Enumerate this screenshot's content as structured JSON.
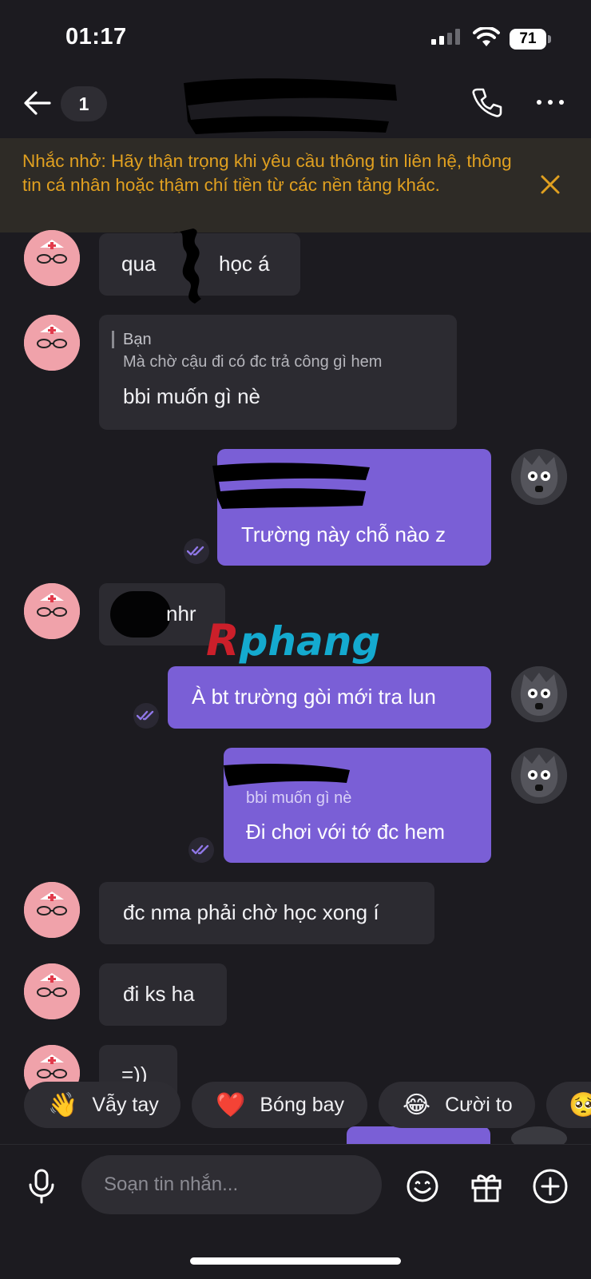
{
  "status_bar": {
    "time": "01:17",
    "battery": "71"
  },
  "header": {
    "unread_count": "1"
  },
  "banner": {
    "text": "Nhắc nhở: Hãy thận trọng khi yêu cầu thông tin liên hệ, thông tin cá nhân hoặc thậm chí tiền từ các nền tảng khác."
  },
  "messages": [
    {
      "dir": "in",
      "text_before": "qua",
      "text_after": "học á"
    },
    {
      "dir": "in",
      "reply_name": "Bạn",
      "reply_text": "Mà chờ cậu đi có đc trả công gì hem",
      "text": "bbi muốn gì nè"
    },
    {
      "dir": "out",
      "text": "Trường này chỗ nào z"
    },
    {
      "dir": "in",
      "text": "nhr"
    },
    {
      "dir": "out",
      "text": "À bt trường gòi mới tra lun"
    },
    {
      "dir": "out",
      "reply_text": "bbi muốn gì nè",
      "text": "Đi chơi với tớ đc hem"
    },
    {
      "dir": "in",
      "text": "đc nma phải chờ học xong í"
    },
    {
      "dir": "in",
      "text": "đi ks ha"
    },
    {
      "dir": "in",
      "text": "=))"
    }
  ],
  "watermark": {
    "first": "R",
    "rest": "phang"
  },
  "quick_reactions": [
    {
      "emoji": "👋",
      "label": "Vẫy tay"
    },
    {
      "emoji": "❤️",
      "label": "Bóng bay"
    },
    {
      "emoji": "😂",
      "label": "Cười to"
    },
    {
      "emoji": "🥺",
      "label": ""
    }
  ],
  "composer": {
    "placeholder": "Soạn tin nhắn..."
  },
  "icons": {
    "back": "arrow-left-icon",
    "call": "phone-icon",
    "more": "more-horizontal-icon",
    "close": "close-icon",
    "seen": "double-check-icon",
    "mic": "microphone-icon",
    "sticker": "smiley-icon",
    "gift": "gift-icon",
    "add": "plus-circle-icon"
  },
  "colors": {
    "background": "#1c1b20",
    "outgoing": "#7a5fd6",
    "incoming": "#2c2b31",
    "warning": "#e0a020"
  }
}
